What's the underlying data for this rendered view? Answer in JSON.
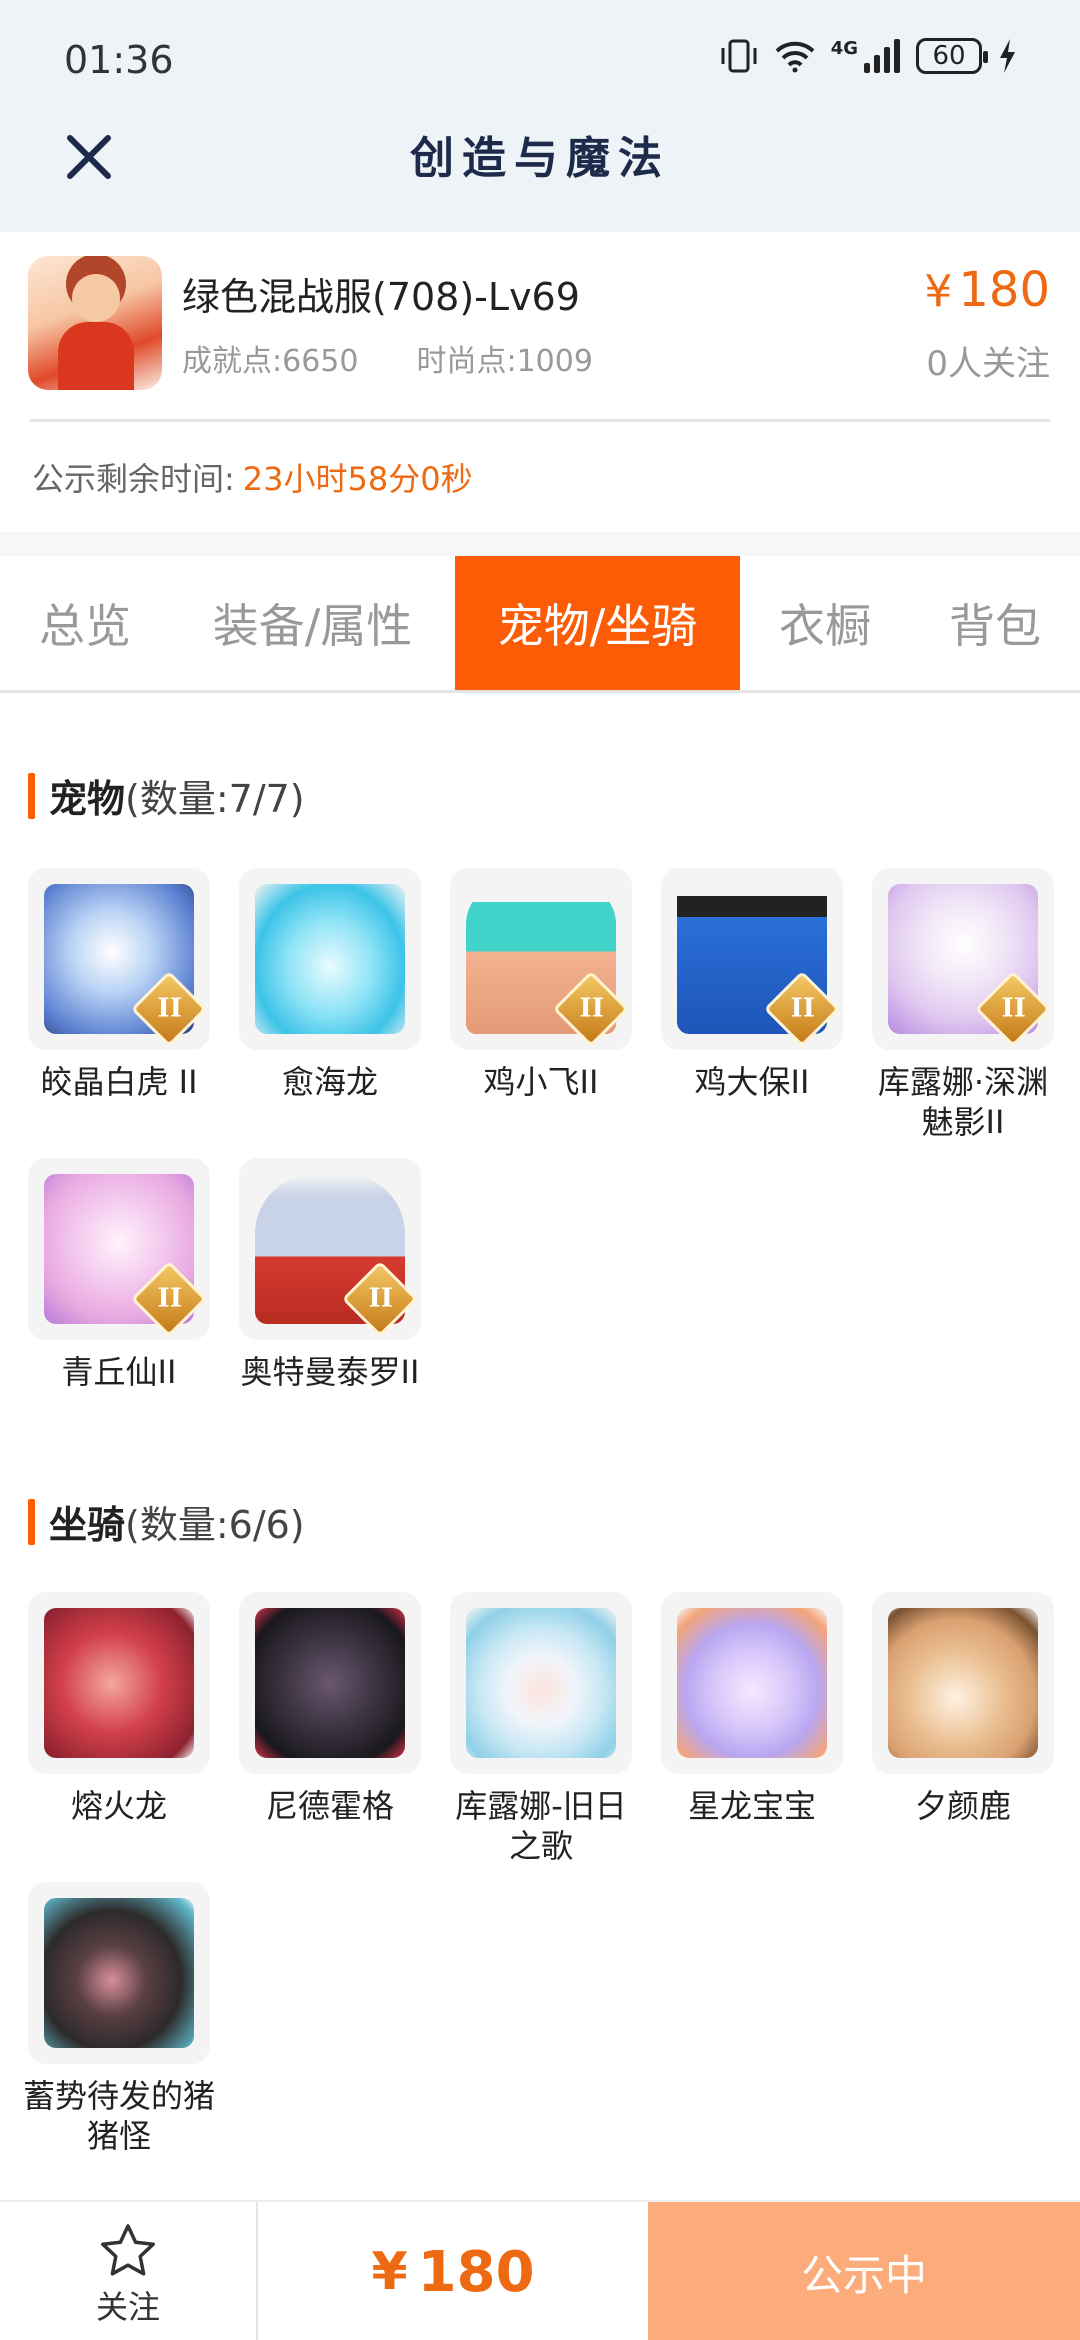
{
  "status_bar": {
    "time": "01:36",
    "network": "4G",
    "battery": "60"
  },
  "header": {
    "title": "创造与魔法"
  },
  "item": {
    "name": "绿色混战服(708)-Lv69",
    "achievement_label": "成就点:6650",
    "fashion_label": "时尚点:1009",
    "price_symbol": "¥",
    "price": "180",
    "followers": "0人关注",
    "countdown_label": "公示剩余时间:",
    "countdown_value": "23小时58分0秒"
  },
  "tabs": [
    {
      "label": "总览",
      "active": false
    },
    {
      "label": "装备/属性",
      "active": false
    },
    {
      "label": "宠物/坐骑",
      "active": true
    },
    {
      "label": "衣橱",
      "active": false
    },
    {
      "label": "背包",
      "active": false
    }
  ],
  "pets": {
    "title": "宠物",
    "count_text": "(数量:7/7)",
    "items": [
      {
        "name": "皎晶白虎 II",
        "icon": "white-tiger",
        "badge": "II",
        "color": "#5a7fd0"
      },
      {
        "name": "愈海龙",
        "icon": "sea-dragon",
        "badge": "",
        "color": "#3cc3e8"
      },
      {
        "name": "鸡小飞II",
        "icon": "chick",
        "badge": "II",
        "color": "#3fd3c9"
      },
      {
        "name": "鸡大保II",
        "icon": "blue-bird",
        "badge": "II",
        "color": "#2a6fd8"
      },
      {
        "name": "库露娜·深渊魅影II",
        "icon": "spirit-girl",
        "badge": "II",
        "color": "#e0c8f0"
      },
      {
        "name": "青丘仙II",
        "icon": "fox-girl",
        "badge": "II",
        "color": "#e9a8e0"
      },
      {
        "name": "奥特曼泰罗II",
        "icon": "ultraman",
        "badge": "II",
        "color": "#c9d3e8"
      }
    ]
  },
  "mounts": {
    "title": "坐骑",
    "count_text": "(数量:6/6)",
    "items": [
      {
        "name": "熔火龙",
        "icon": "fire-dragon",
        "color": "#d2404a"
      },
      {
        "name": "尼德霍格",
        "icon": "dark-dragon",
        "color": "#3a3340"
      },
      {
        "name": "库露娜-旧日之歌",
        "icon": "cloud-girl",
        "color": "#8fd0e8"
      },
      {
        "name": "星龙宝宝",
        "icon": "star-dragon",
        "color": "#b9a6f0"
      },
      {
        "name": "夕颜鹿",
        "icon": "deer",
        "color": "#d9a070"
      },
      {
        "name": "蓄势待发的猪猪怪",
        "icon": "pig",
        "color": "#2d2a2a"
      }
    ]
  },
  "bottom_bar": {
    "follow_label": "关注",
    "price_symbol": "¥",
    "price": "180",
    "status_label": "公示中"
  }
}
